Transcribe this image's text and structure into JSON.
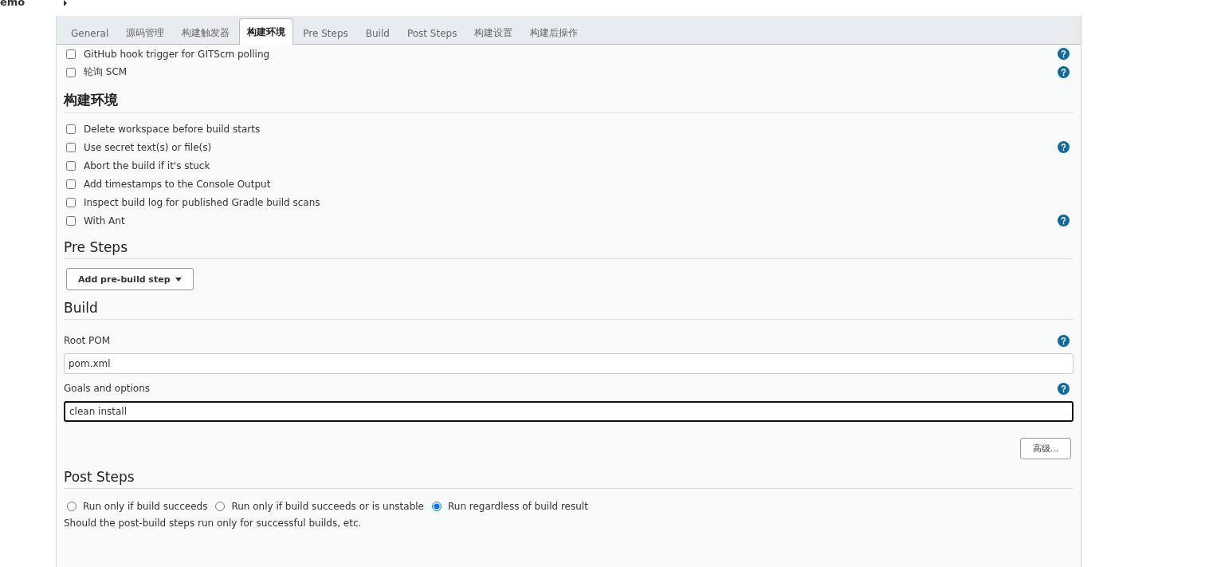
{
  "breadcrumb": {
    "text": "emo"
  },
  "tabs": [
    {
      "label": "General",
      "selected": false
    },
    {
      "label": "源码管理",
      "selected": false
    },
    {
      "label": "构建触发器",
      "selected": false
    },
    {
      "label": "构建环境",
      "selected": true
    },
    {
      "label": "Pre Steps",
      "selected": false
    },
    {
      "label": "Build",
      "selected": false
    },
    {
      "label": "Post Steps",
      "selected": false
    },
    {
      "label": "构建设置",
      "selected": false
    },
    {
      "label": "构建后操作",
      "selected": false
    }
  ],
  "trigger_options": [
    {
      "label": "GitHub hook trigger for GITScm polling",
      "checked": false,
      "help": true
    },
    {
      "label": "轮询 SCM",
      "checked": false,
      "help": true
    }
  ],
  "build_environment": {
    "title": "构建环境",
    "options": [
      {
        "label": "Delete workspace before build starts",
        "checked": false,
        "help": false
      },
      {
        "label": "Use secret text(s) or file(s)",
        "checked": false,
        "help": true
      },
      {
        "label": "Abort the build if it's stuck",
        "checked": false,
        "help": false
      },
      {
        "label": "Add timestamps to the Console Output",
        "checked": false,
        "help": false
      },
      {
        "label": "Inspect build log for published Gradle build scans",
        "checked": false,
        "help": false
      },
      {
        "label": "With Ant",
        "checked": false,
        "help": true
      }
    ]
  },
  "pre_steps": {
    "title": "Pre Steps",
    "button": "Add pre-build step"
  },
  "build": {
    "title": "Build",
    "fields": [
      {
        "label": "Root POM",
        "value": "pom.xml",
        "focused": false,
        "help": true
      },
      {
        "label": "Goals and options",
        "value": "clean install",
        "focused": true,
        "help": true
      }
    ],
    "advanced_button": "高级..."
  },
  "post_steps": {
    "title": "Post Steps",
    "options": [
      {
        "label": "Run only if build succeeds",
        "selected": false
      },
      {
        "label": "Run only if build succeeds or is unstable",
        "selected": false
      },
      {
        "label": "Run regardless of build result",
        "selected": true
      }
    ],
    "description": "Should the post-build steps run only for successful builds, etc."
  }
}
